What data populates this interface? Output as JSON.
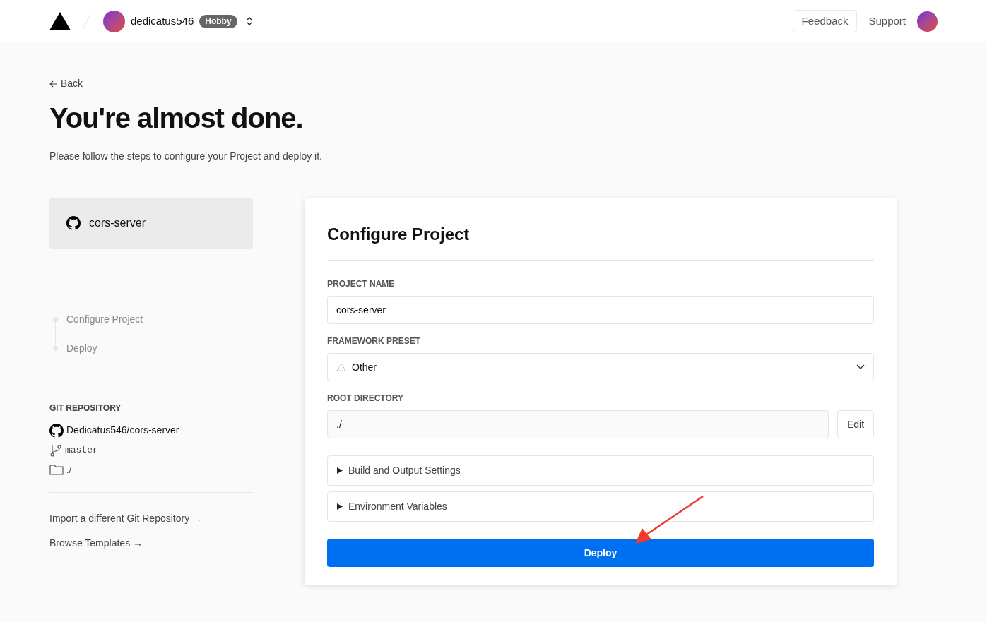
{
  "header": {
    "team": "dedicatus546",
    "plan": "Hobby",
    "links": [
      "Feedback",
      "Support"
    ]
  },
  "back": "Back",
  "title": "You're almost done.",
  "subtitle": "Please follow the steps to configure your Project and deploy it.",
  "repo_card": {
    "name": "cors-server"
  },
  "steps": [
    "Configure Project",
    "Deploy"
  ],
  "git": {
    "heading": "GIT REPOSITORY",
    "repo": "Dedicatus546/cors-server",
    "branch": "master",
    "directory": "./"
  },
  "links": [
    "Import a different Git Repository →",
    "Browse Templates →"
  ],
  "form": {
    "title": "Configure Project",
    "project_name": {
      "label": "PROJECT NAME",
      "value": "cors-server"
    },
    "framework": {
      "label": "FRAMEWORK PRESET",
      "value": "Other"
    },
    "root": {
      "label": "ROOT DIRECTORY",
      "value": "./",
      "button": "Edit"
    },
    "sections": [
      {
        "label": "Build and Output Settings",
        "expanded": false
      },
      {
        "label": "Environment Variables",
        "expanded": false
      }
    ],
    "deploy": "Deploy"
  }
}
